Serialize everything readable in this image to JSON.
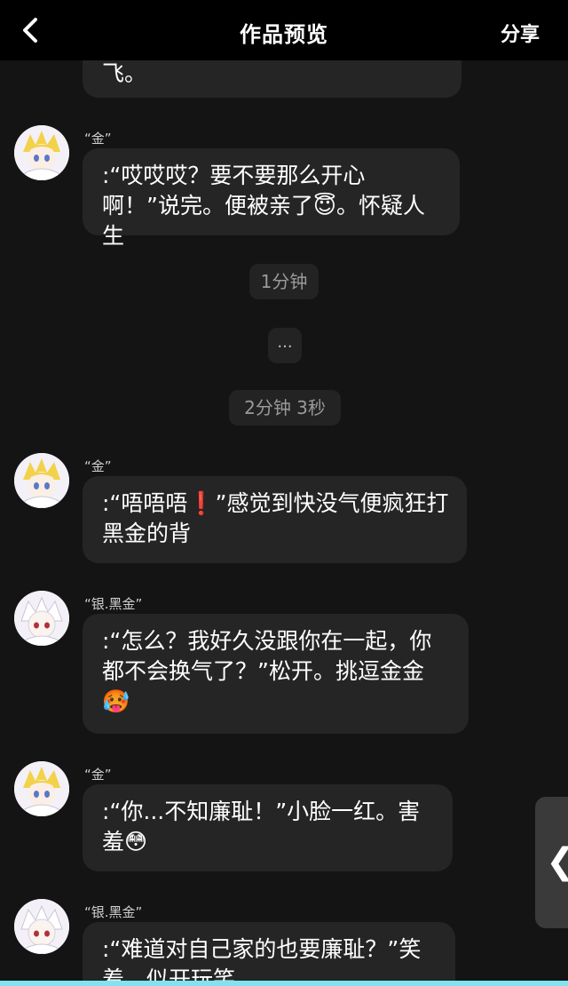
{
  "header": {
    "title": "作品预览",
    "share_label": "分享"
  },
  "messages": [
    {
      "sender": "",
      "text": "飞。",
      "partial": true
    },
    {
      "sender": "“金”",
      "text": ":“哎哎哎？要不要那么开心啊！”说完。便被亲了😇。怀疑人生"
    },
    {
      "sender": "“金”",
      "text": ":“唔唔唔❗️”感觉到快没气便疯狂打黑金的背"
    },
    {
      "sender": "“银.黑金”",
      "text": ":“怎么？我好久没跟你在一起，你都不会换气了？”松开。挑逗金金🥵"
    },
    {
      "sender": "“金”",
      "text": ":“你...不知廉耻！”小脸一红。害羞😳"
    },
    {
      "sender": "“银.黑金”",
      "text": ":“难道对自己家的也要廉耻？”笑着。似开玩笑"
    }
  ],
  "timestamps": [
    "1分钟",
    "2分钟 3秒"
  ],
  "ellipsis": "...",
  "side_handle": "❮",
  "icons": {
    "back": "chevron-left-icon",
    "side": "chevron-left-icon"
  },
  "colors": {
    "header_bg": "#000000",
    "page_bg": "#141414",
    "bubble_bg": "#252525",
    "accent_bottom": "#7fe3f0"
  }
}
